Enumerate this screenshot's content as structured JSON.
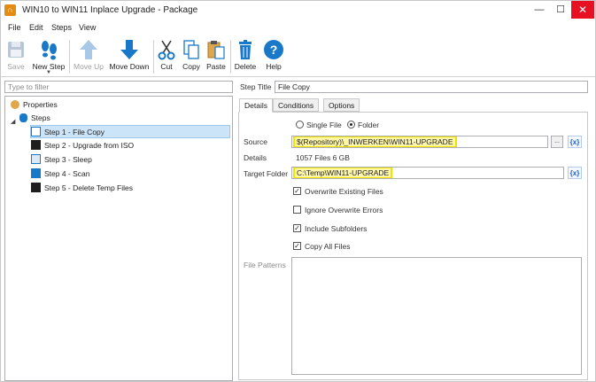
{
  "window": {
    "title": "WIN10 to WIN11 Inplace Upgrade - Package"
  },
  "menu": [
    "File",
    "Edit",
    "Steps",
    "View"
  ],
  "toolbar": {
    "save": "Save",
    "new_step": "New Step",
    "move_up": "Move Up",
    "move_down": "Move Down",
    "cut": "Cut",
    "copy": "Copy",
    "paste": "Paste",
    "delete": "Delete",
    "help": "Help"
  },
  "filter": {
    "placeholder": "Type to filter"
  },
  "tree": {
    "properties": "Properties",
    "steps": "Steps",
    "items": [
      "Step 1 - File Copy",
      "Step 2 - Upgrade from ISO",
      "Step 3 - Sleep",
      "Step 4 - Scan",
      "Step 5 - Delete Temp Files"
    ]
  },
  "step": {
    "title_label": "Step Title",
    "title_value": "File Copy"
  },
  "tabs": [
    "Details",
    "Conditions",
    "Options"
  ],
  "details": {
    "single_file": "Single File",
    "folder": "Folder",
    "source_label": "Source",
    "source_value": "$(Repository)\\_INWERKEN\\WIN11-UPGRADE",
    "details_label": "Details",
    "details_value": "1057 Files 6 GB",
    "target_label": "Target Folder",
    "target_value": "C:\\Temp\\WIN11-UPGRADE",
    "browse": "...",
    "fx": "{x}",
    "checks": [
      {
        "label": "Overwrite Existing Files",
        "checked": true
      },
      {
        "label": "Ignore Overwrite Errors",
        "checked": false
      },
      {
        "label": "Include Subfolders",
        "checked": true
      },
      {
        "label": "Copy All Files",
        "checked": true
      }
    ],
    "file_patterns_label": "File Patterns"
  },
  "colors": {
    "selection": "#cce4f7",
    "highlight": "#f2e200",
    "close": "#e81123",
    "accent": "#1a78c9"
  }
}
